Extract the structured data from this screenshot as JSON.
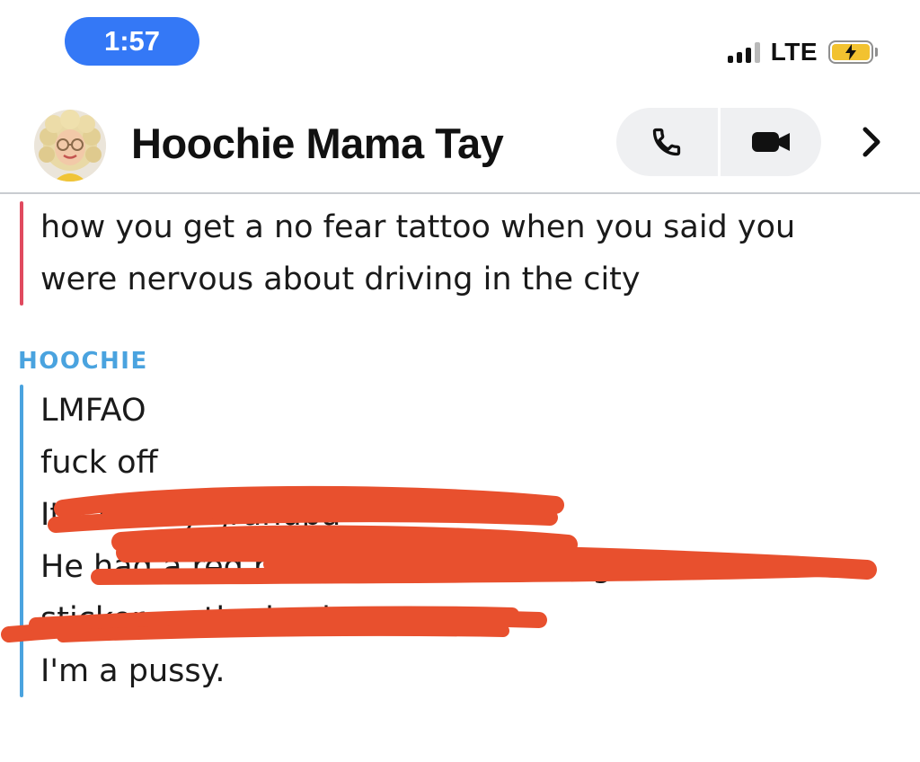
{
  "status_bar": {
    "time": "1:57",
    "network": "LTE",
    "signal_bars": 4,
    "battery_state": "charging",
    "icons": [
      "signal-icon",
      "battery-charging-icon"
    ]
  },
  "header": {
    "contact_name": "Hoochie Mama Tay",
    "avatar": "bitmoji-avatar",
    "actions": [
      {
        "name": "phone-call",
        "icon": "phone-icon"
      },
      {
        "name": "video-call",
        "icon": "video-camera-icon"
      },
      {
        "name": "more",
        "icon": "chevron-right-icon"
      }
    ]
  },
  "messages": [
    {
      "sender": "",
      "accent_color": "#e04a5f",
      "lines": [
        "how you get a no fear tattoo when you said you",
        "were nervous about driving in the city"
      ]
    },
    {
      "sender": "HOOCHIE",
      "accent_color": "#4aa3df",
      "lines": [
        "LMFAO",
        "fuck off",
        "It's for my grandpa",
        "He had a red pickup truck with a big No Fear",
        "sticker on the back",
        "I'm a pussy."
      ]
    }
  ],
  "colors": {
    "time_pill": "#3478f6",
    "scribble": "#e8502e",
    "header_rule": "#c9ccd1"
  }
}
